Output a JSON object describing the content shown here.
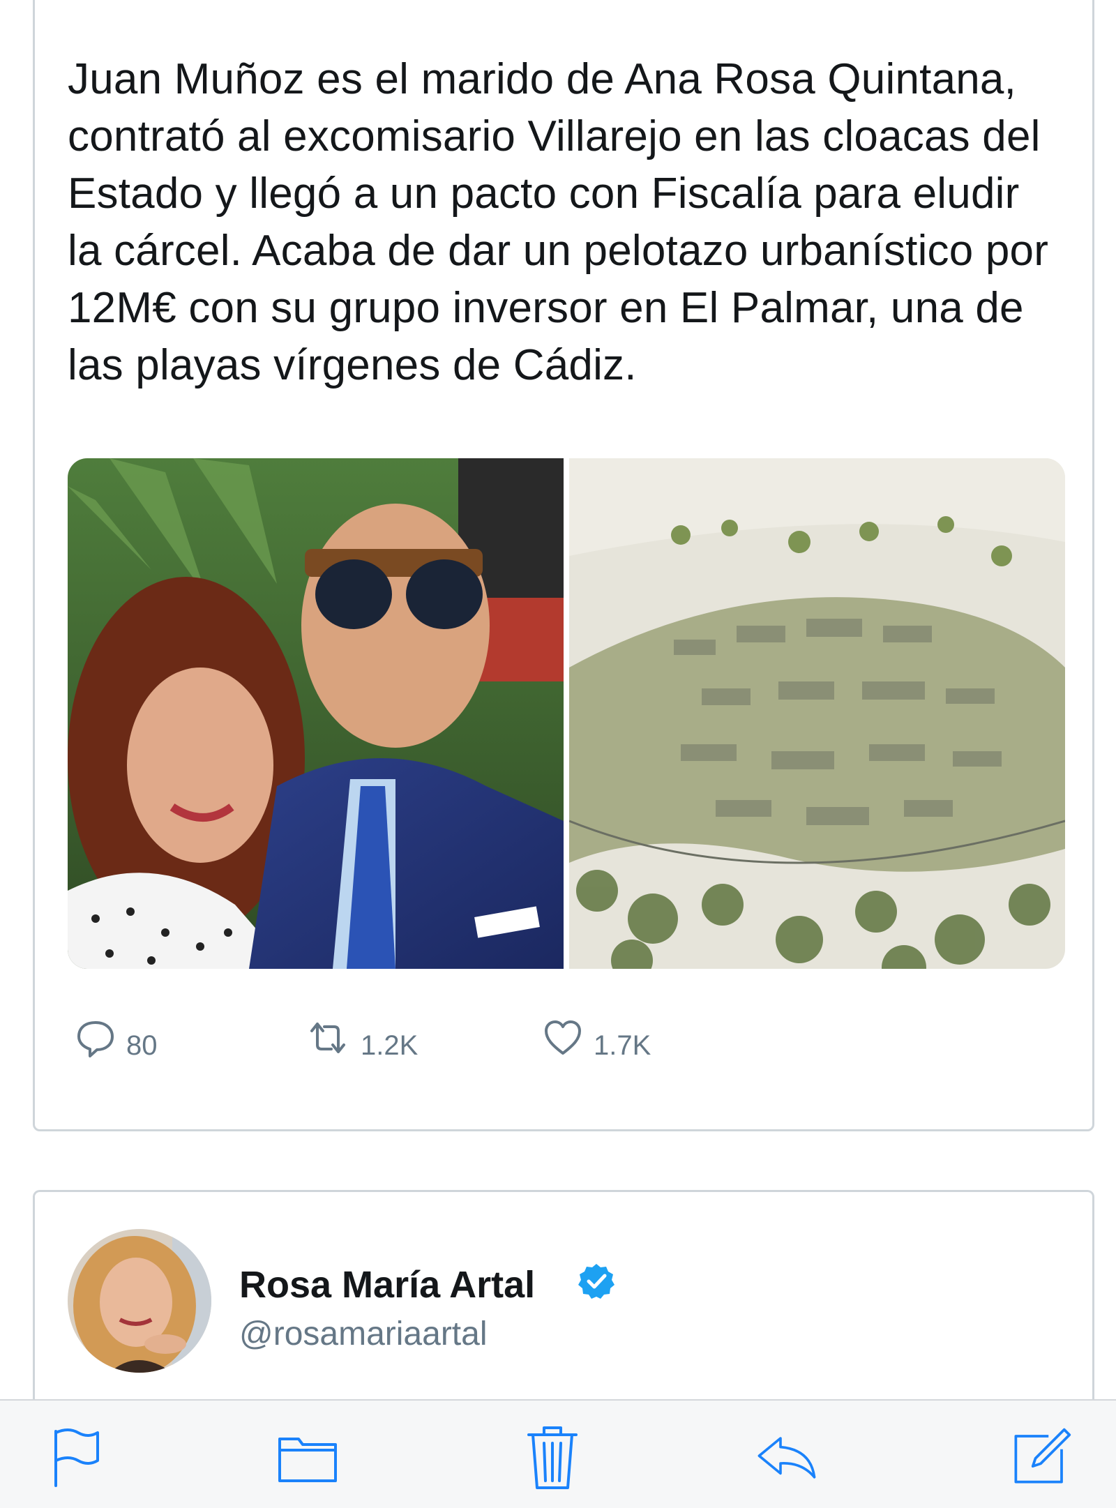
{
  "tweet": {
    "text": "Juan Muñoz es el marido de Ana Rosa Quintana, contrató al excomisario Villarejo en las cloacas del Estado y llegó a un pacto con Fiscalía para eludir la cárcel. Acaba de dar un pelotazo urbanístico por 12M€ con su grupo inversor en El Palmar, una de las playas vírgenes de Cádiz.",
    "actions": {
      "replies": "80",
      "retweets": "1.2K",
      "likes": "1.7K"
    }
  },
  "next_tweet": {
    "author_name": "Rosa María Artal",
    "author_handle": "@rosamariaartal",
    "verified": true
  },
  "colors": {
    "accent": "#1da1f2",
    "text": "#14171a",
    "muted": "#657786",
    "toolbar_icon": "#1a82fb"
  },
  "toolbar": {
    "icons": [
      "flag-icon",
      "folder-icon",
      "trash-icon",
      "reply-icon",
      "compose-icon"
    ]
  }
}
